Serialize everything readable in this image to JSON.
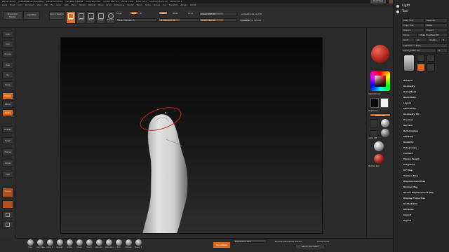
{
  "app": {
    "title_items": [
      "ZBrush 4R7 P3",
      "[\\cas\\Zb\\ZBrush] Data.ZPR]",
      "ZBrush Document",
      "Free Mem 5.681GB",
      "Active Mem 491",
      "Scratch Disk 151",
      "ZTime 1.914",
      "Timer 1.074",
      "PolyCount 6.153 KP",
      "MeshCount 1"
    ],
    "quicksave": "QuickSave",
    "ui_mode": "Interface",
    "menus_label": "Menus",
    "script_label": "DefaultZScript",
    "window_controls": [
      "–",
      "□",
      "×"
    ]
  },
  "menubar": [
    "Alpha",
    "Brush",
    "Color",
    "Document",
    "Draw",
    "Edit",
    "File",
    "Layer",
    "Light",
    "Macro",
    "Marker",
    "Material",
    "Movie",
    "Picker",
    "Preferences",
    "Render",
    "Stencil",
    "Stroke",
    "Texture",
    "Tool",
    "Transform",
    "Zplugin",
    "Zscript"
  ],
  "topshelf": {
    "projection_master": "Projection Master",
    "lightbox": "LightBox",
    "quick_sketch": "Quick Sketch",
    "edit": "Edit",
    "draw": "Draw",
    "move": "Move",
    "scale": "Scale",
    "rotate": "Rotate",
    "mrgb": "Mrgb",
    "rgb": "Rgb",
    "m": "M",
    "zadd": "Zadd",
    "zsub": "Zsub",
    "zcut": "Zcut",
    "rgb_intensity": "Rgb Intensity 5",
    "z_intensity": "Z Intensity 51",
    "focal_shift": "Focal Shift 28",
    "draw_size": "Draw Size 64",
    "dynamic": "Dynamic",
    "active_points": "ActivePoints: 6,279",
    "total_points": "TotalPoints: 72,007"
  },
  "progress": {
    "rgb_intensity": 0.05,
    "z_intensity": 0.51,
    "focal_shift": 0.64,
    "draw_size": 0.64
  },
  "leftshelf": [
    "Sdiv",
    "Sim",
    "Shade",
    "Sub",
    "Xy",
    "Snap",
    "Frame",
    "Move",
    "Scale",
    "Rotate",
    "Polyf",
    "Transp",
    "Ghost",
    "Solo",
    "Xpose"
  ],
  "rightshelf": {
    "gradient": "Gradient",
    "switch_color": "SwitchColor",
    "alternate": "Alternate",
    "sphere": "Sphere",
    "alpha_off": "Alpha Off",
    "texture_off": "Texture Off",
    "matcap": "MatCap Red"
  },
  "tray": {
    "light": "Light",
    "tool": "Tool",
    "rows": [
      [
        "Load Tool",
        "Save As"
      ],
      [
        "Copy Tool",
        "Paste"
      ],
      [
        "Import",
        "Export"
      ],
      [
        "Clone",
        "Make PolyMesh3D"
      ],
      [
        "GoZ",
        "All",
        "Visible",
        "R"
      ],
      [
        "Lightbox > Tools"
      ],
      [
        "hand_index: 40",
        "R"
      ]
    ],
    "menus": [
      "SubTool",
      "Geometry",
      "ArrayMesh",
      "NanoMesh",
      "Layers",
      "FiberMesh",
      "Geometry HD",
      "Preview",
      "Surface",
      "Deformation",
      "Masking",
      "Visibility",
      "Polygroups",
      "Contact",
      "Morph Target",
      "Polypaint",
      "UV Map",
      "Texture Map",
      "Displacement Map",
      "Normal Map",
      "Vector Displacement Map",
      "Display Properties",
      "Unified Skin",
      "Initialize",
      "Import",
      "Export"
    ]
  },
  "bottomshelf": {
    "brushes": [
      "Clay",
      "ClayTube",
      "Dam_S",
      "Hpolish",
      "Inflat",
      "Move",
      "Pinch",
      "Smooth",
      "Standard",
      "Trim",
      "hPolish",
      "Move_T"
    ],
    "dyna_mesh": "DynaMesh",
    "resolution": "Resolution 128",
    "backface_mask": "BackfaceMask",
    "del_hidden": "Del Hidden",
    "close_holes": "Close Holes",
    "mirror_weld": "Mirror And Weld"
  },
  "colors": {
    "accent": "#e06a1c",
    "background": "#2a2a2a",
    "selection_ring": "#d21e1e"
  }
}
